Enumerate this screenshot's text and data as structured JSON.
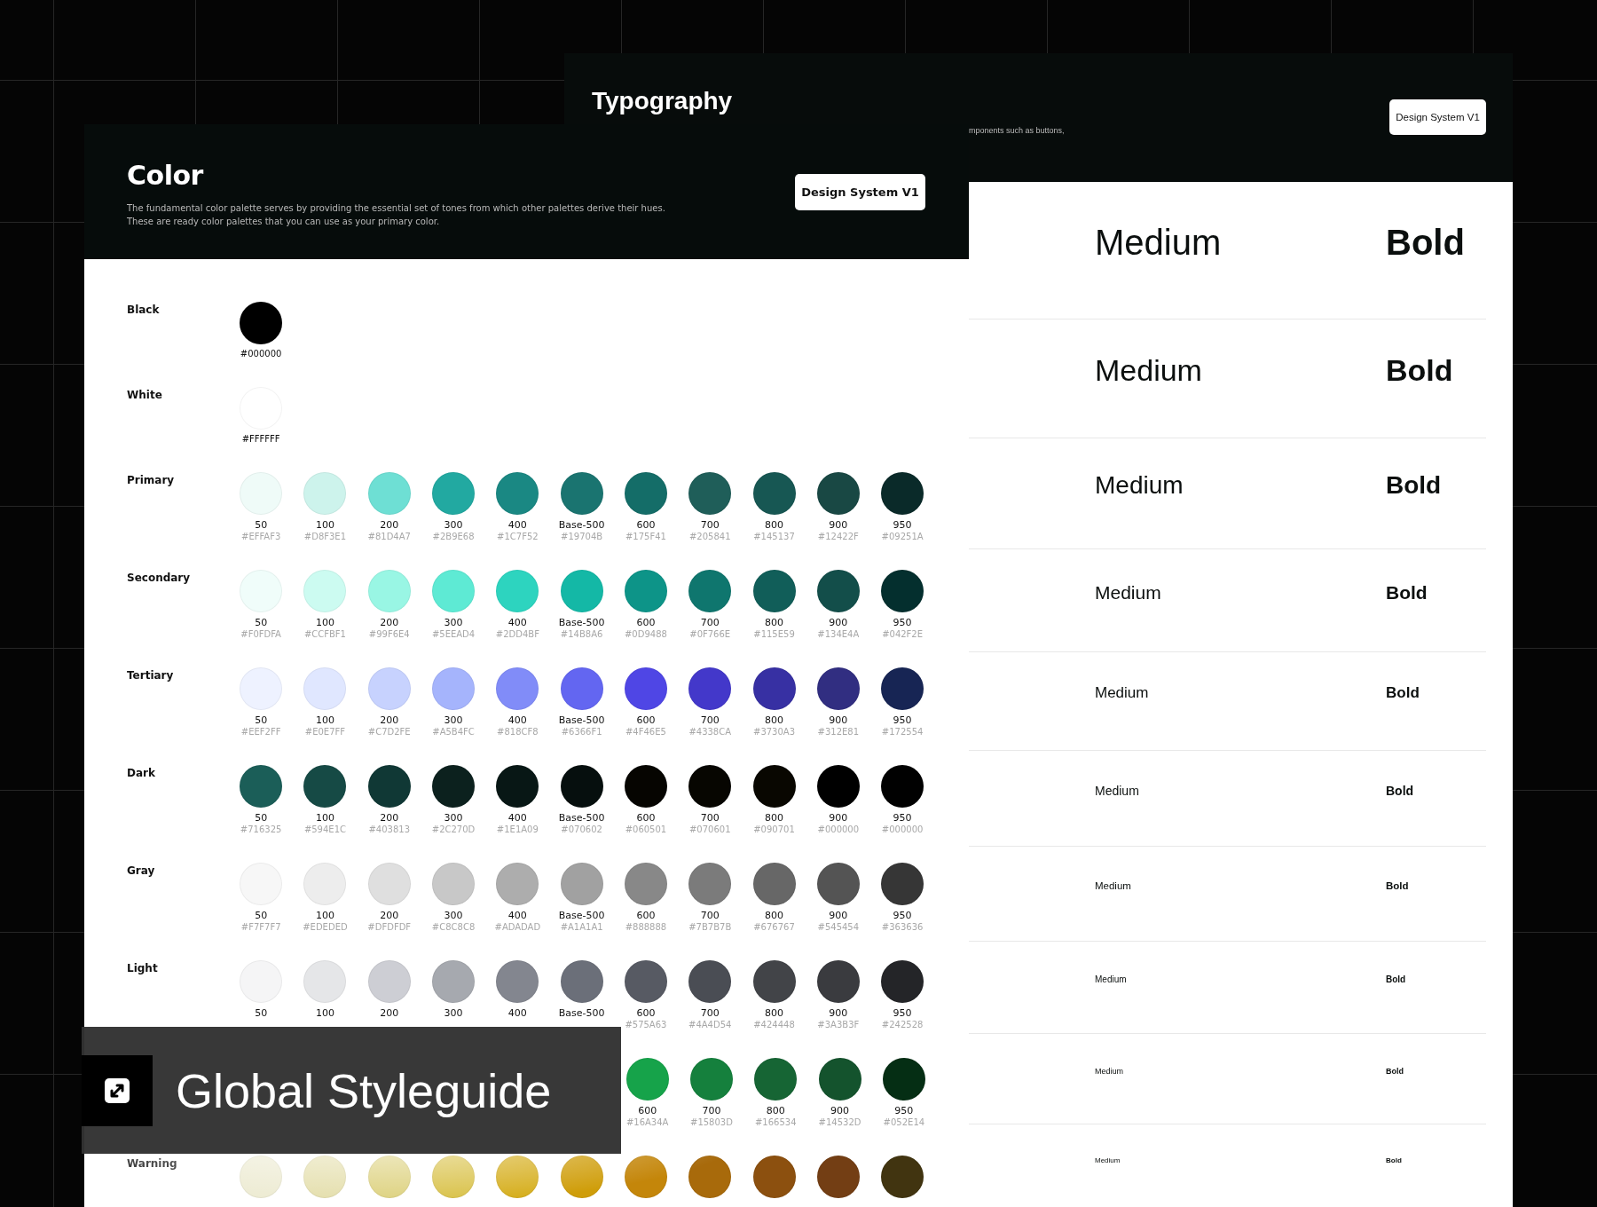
{
  "typography_card": {
    "title": "Typography",
    "description": "mponents such as buttons,",
    "badge": "Design System V1",
    "rows": [
      {
        "medium": "Medium",
        "bold": "Bold"
      },
      {
        "medium": "Medium",
        "bold": "Bold"
      },
      {
        "medium": "Medium",
        "bold": "Bold"
      },
      {
        "medium": "Medium",
        "bold": "Bold"
      },
      {
        "medium": "Medium",
        "bold": "Bold"
      },
      {
        "medium": "Medium",
        "bold": "Bold"
      },
      {
        "medium": "Medium",
        "bold": "Bold"
      },
      {
        "medium": "Medium",
        "bold": "Bold"
      },
      {
        "medium": "Medium",
        "bold": "Bold"
      },
      {
        "medium": "Medium",
        "bold": "Bold"
      }
    ]
  },
  "color_card": {
    "title": "Color",
    "description_lines": [
      "The fundamental color palette serves by providing the essential set of tones from which other palettes derive their hues.",
      "These are ready color palettes that you can use as your primary color."
    ],
    "badge": "Design System V1",
    "palettes": [
      {
        "kind": "single",
        "name": "Black",
        "swatches": [
          {
            "color": "#000000",
            "hex": "#000000"
          }
        ]
      },
      {
        "kind": "single",
        "name": "White",
        "swatches": [
          {
            "color": "#ffffff",
            "hex": "#FFFFFF"
          }
        ]
      },
      {
        "kind": "scale",
        "name": "Primary",
        "swatches": [
          {
            "color": "#effbf8",
            "label": "50",
            "hex": "#EFFAF3"
          },
          {
            "color": "#cdf3ec",
            "label": "100",
            "hex": "#D8F3E1"
          },
          {
            "color": "#6edfd4",
            "label": "200",
            "hex": "#81D4A7"
          },
          {
            "color": "#22a9a1",
            "label": "300",
            "hex": "#2B9E68"
          },
          {
            "color": "#1a8883",
            "label": "400",
            "hex": "#1C7F52"
          },
          {
            "color": "#1a7470",
            "label": "Base-500",
            "hex": "#19704B"
          },
          {
            "color": "#146d68",
            "label": "600",
            "hex": "#175F41"
          },
          {
            "color": "#1f5e59",
            "label": "700",
            "hex": "#205841"
          },
          {
            "color": "#175753",
            "label": "800",
            "hex": "#145137"
          },
          {
            "color": "#194844",
            "label": "900",
            "hex": "#12422F"
          },
          {
            "color": "#0a2a29",
            "label": "950",
            "hex": "#09251A"
          }
        ]
      },
      {
        "kind": "scale",
        "name": "Secondary",
        "swatches": [
          {
            "color": "#f0fdfa",
            "label": "50",
            "hex": "#F0FDFA"
          },
          {
            "color": "#ccfbf1",
            "label": "100",
            "hex": "#CCFBF1"
          },
          {
            "color": "#99f6e4",
            "label": "200",
            "hex": "#99F6E4"
          },
          {
            "color": "#5eead4",
            "label": "300",
            "hex": "#5EEAD4"
          },
          {
            "color": "#2dd4bf",
            "label": "400",
            "hex": "#2DD4BF"
          },
          {
            "color": "#14b8a6",
            "label": "Base-500",
            "hex": "#14B8A6"
          },
          {
            "color": "#0d9488",
            "label": "600",
            "hex": "#0D9488"
          },
          {
            "color": "#0f766e",
            "label": "700",
            "hex": "#0F766E"
          },
          {
            "color": "#115e59",
            "label": "800",
            "hex": "#115E59"
          },
          {
            "color": "#134e4a",
            "label": "900",
            "hex": "#134E4A"
          },
          {
            "color": "#042f2e",
            "label": "950",
            "hex": "#042F2E"
          }
        ]
      },
      {
        "kind": "scale",
        "name": "Tertiary",
        "swatches": [
          {
            "color": "#eef2ff",
            "label": "50",
            "hex": "#EEF2FF"
          },
          {
            "color": "#e0e7ff",
            "label": "100",
            "hex": "#E0E7FF"
          },
          {
            "color": "#c7d2fe",
            "label": "200",
            "hex": "#C7D2FE"
          },
          {
            "color": "#a5b4fc",
            "label": "300",
            "hex": "#A5B4FC"
          },
          {
            "color": "#818cf8",
            "label": "400",
            "hex": "#818CF8"
          },
          {
            "color": "#6366f1",
            "label": "Base-500",
            "hex": "#6366F1"
          },
          {
            "color": "#4f46e5",
            "label": "600",
            "hex": "#4F46E5"
          },
          {
            "color": "#4338ca",
            "label": "700",
            "hex": "#4338CA"
          },
          {
            "color": "#3730a3",
            "label": "800",
            "hex": "#3730A3"
          },
          {
            "color": "#312e81",
            "label": "900",
            "hex": "#312E81"
          },
          {
            "color": "#172554",
            "label": "950",
            "hex": "#172554"
          }
        ]
      },
      {
        "kind": "scale",
        "name": "Dark",
        "swatches": [
          {
            "color": "#1b5e58",
            "label": "50",
            "hex": "#716325"
          },
          {
            "color": "#164a45",
            "label": "100",
            "hex": "#594E1C"
          },
          {
            "color": "#103835",
            "label": "200",
            "hex": "#403813"
          },
          {
            "color": "#0c211e",
            "label": "300",
            "hex": "#2C270D"
          },
          {
            "color": "#081715",
            "label": "400",
            "hex": "#1E1A09"
          },
          {
            "color": "#060f0e",
            "label": "Base-500",
            "hex": "#070602"
          },
          {
            "color": "#060501",
            "label": "600",
            "hex": "#060501"
          },
          {
            "color": "#070601",
            "label": "700",
            "hex": "#070601"
          },
          {
            "color": "#090701",
            "label": "800",
            "hex": "#090701"
          },
          {
            "color": "#000000",
            "label": "900",
            "hex": "#000000"
          },
          {
            "color": "#010101",
            "label": "950",
            "hex": "#000000"
          }
        ]
      },
      {
        "kind": "scale",
        "name": "Gray",
        "swatches": [
          {
            "color": "#f7f7f7",
            "label": "50",
            "hex": "#F7F7F7"
          },
          {
            "color": "#ededed",
            "label": "100",
            "hex": "#EDEDED"
          },
          {
            "color": "#dfdfdf",
            "label": "200",
            "hex": "#DFDFDF"
          },
          {
            "color": "#c8c8c8",
            "label": "300",
            "hex": "#C8C8C8"
          },
          {
            "color": "#adadad",
            "label": "400",
            "hex": "#ADADAD"
          },
          {
            "color": "#a1a1a1",
            "label": "Base-500",
            "hex": "#A1A1A1"
          },
          {
            "color": "#888888",
            "label": "600",
            "hex": "#888888"
          },
          {
            "color": "#7b7b7b",
            "label": "700",
            "hex": "#7B7B7B"
          },
          {
            "color": "#676767",
            "label": "800",
            "hex": "#676767"
          },
          {
            "color": "#545454",
            "label": "900",
            "hex": "#545454"
          },
          {
            "color": "#363636",
            "label": "950",
            "hex": "#363636"
          }
        ]
      },
      {
        "kind": "scale",
        "name": "Light",
        "swatches": [
          {
            "color": "#f5f5f6",
            "label": "50"
          },
          {
            "color": "#e5e6e8",
            "label": "100"
          },
          {
            "color": "#cdced4",
            "label": "200"
          },
          {
            "color": "#a6a9af",
            "label": "300"
          },
          {
            "color": "#83868f",
            "label": "400"
          },
          {
            "color": "#6b6f79",
            "label": "Base-500"
          },
          {
            "color": "#575a63",
            "label": "600",
            "hex": "#575A63"
          },
          {
            "color": "#4a4d54",
            "label": "700",
            "hex": "#4A4D54"
          },
          {
            "color": "#424448",
            "label": "800",
            "hex": "#424448"
          },
          {
            "color": "#3a3b3f",
            "label": "900",
            "hex": "#3A3B3F"
          },
          {
            "color": "#242528",
            "label": "950",
            "hex": "#242528"
          }
        ]
      },
      {
        "kind": "tail",
        "swatches": [
          {
            "color": "#16a34a",
            "label": "600",
            "hex": "#16A34A"
          },
          {
            "color": "#15803d",
            "label": "700",
            "hex": "#15803D"
          },
          {
            "color": "#166534",
            "label": "800",
            "hex": "#166534"
          },
          {
            "color": "#14532d",
            "label": "900",
            "hex": "#14532D"
          },
          {
            "color": "#052e14",
            "label": "950",
            "hex": "#052E14"
          }
        ]
      },
      {
        "kind": "scale",
        "name": "Warning",
        "swatches": [
          {
            "color": "#ecead0"
          },
          {
            "color": "#e3dda8"
          },
          {
            "color": "#dcd07a"
          },
          {
            "color": "#d8c044"
          },
          {
            "color": "#d5ad1a"
          },
          {
            "color": "#cf9d09"
          },
          {
            "color": "#c4860a"
          },
          {
            "color": "#a86a0b"
          },
          {
            "color": "#8c500f"
          },
          {
            "color": "#733e14"
          },
          {
            "color": "#413410"
          }
        ]
      }
    ]
  },
  "banner": {
    "title": "Global Styleguide"
  }
}
